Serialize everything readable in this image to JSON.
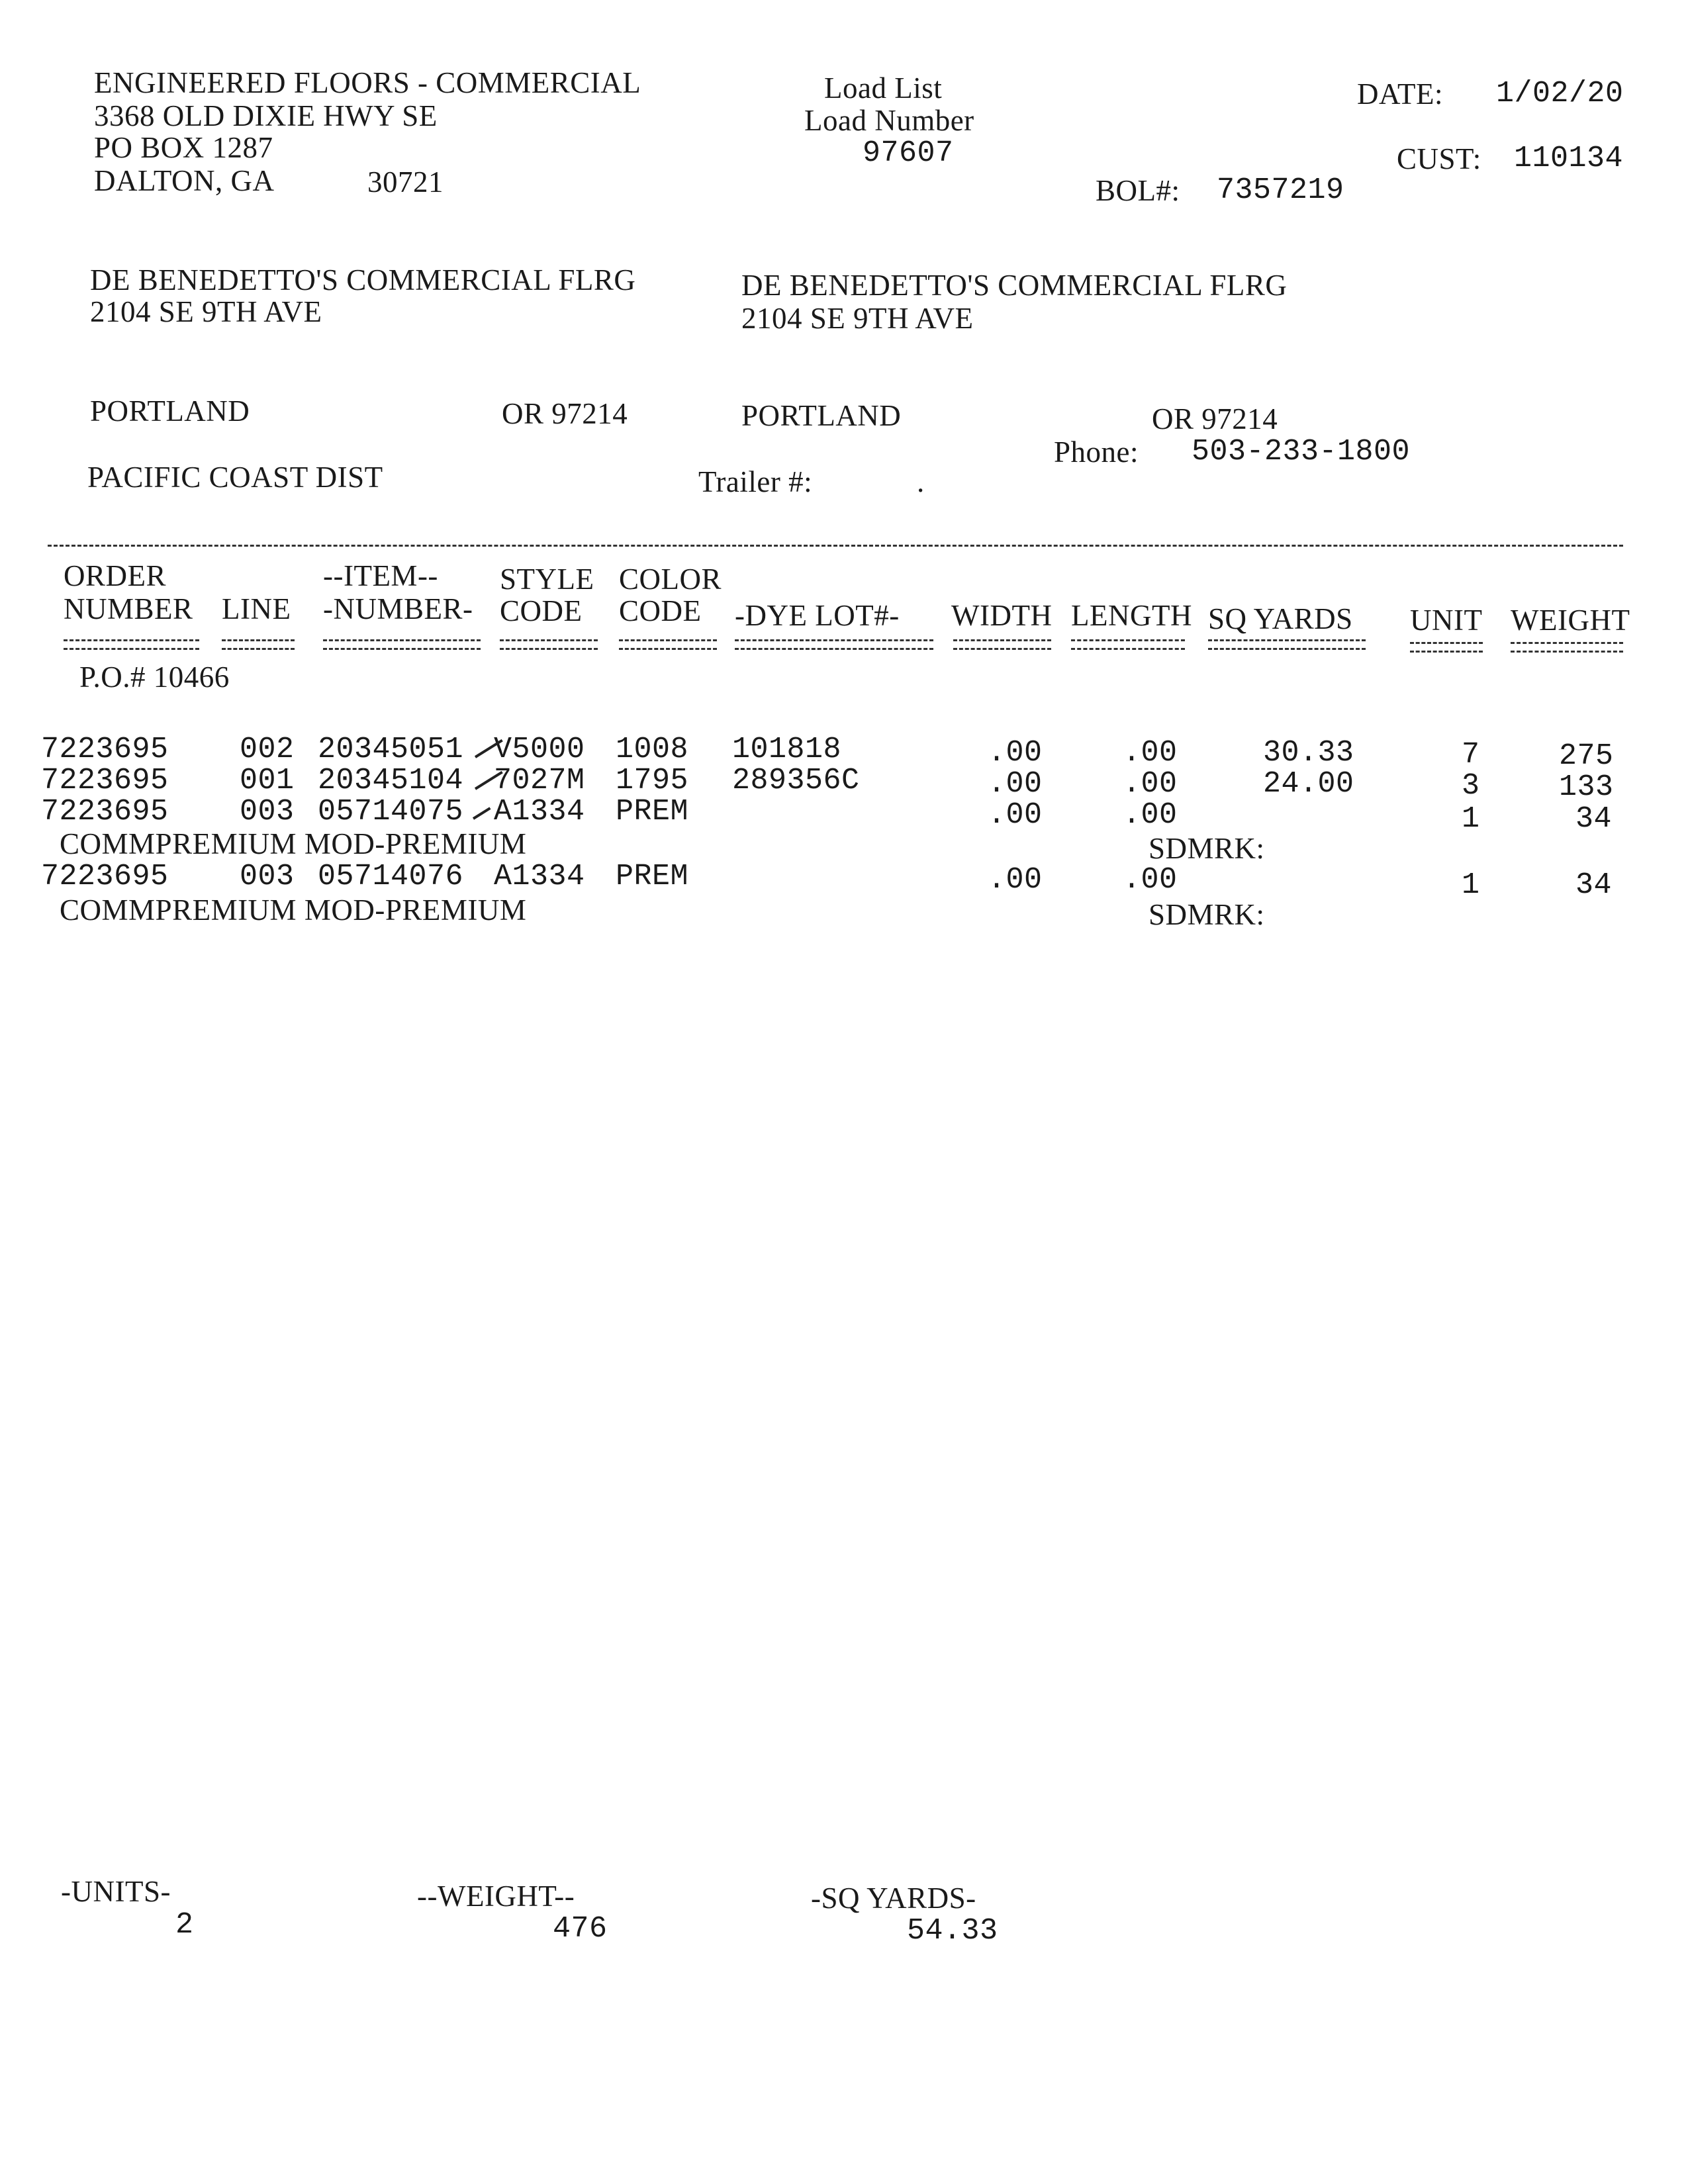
{
  "company": {
    "name": "ENGINEERED FLOORS - COMMERCIAL",
    "address1": "3368 OLD DIXIE HWY SE",
    "address2": "PO BOX 1287",
    "city_state": "DALTON, GA",
    "zip": "30721"
  },
  "doc": {
    "title": "Load List",
    "load_number_label": "Load Number",
    "load_number": "97607",
    "date_label": "DATE:",
    "date": "1/02/20",
    "cust_label": "CUST:",
    "cust": "110134",
    "bol_label": "BOL#:",
    "bol": "7357219"
  },
  "sold_to": {
    "name": "DE BENEDETTO'S COMMERCIAL FLRG",
    "address": "2104 SE 9TH AVE",
    "city": "PORTLAND",
    "state_zip": "OR 97214"
  },
  "ship_to": {
    "name": "DE BENEDETTO'S COMMERCIAL FLRG",
    "address": "2104 SE 9TH AVE",
    "city": "PORTLAND",
    "state_zip": "OR 97214",
    "phone_label": "Phone:",
    "phone": "503-233-1800"
  },
  "carrier": "PACIFIC COAST DIST",
  "trailer_label": "Trailer #:",
  "trailer": ".",
  "headers": {
    "order": [
      "ORDER",
      "NUMBER"
    ],
    "line": "LINE",
    "item": [
      "--ITEM--",
      "-NUMBER-"
    ],
    "style": [
      "STYLE",
      "CODE"
    ],
    "color": [
      "COLOR",
      "CODE"
    ],
    "dye_lot": "-DYE LOT#-",
    "width": "WIDTH",
    "length": "LENGTH",
    "sq_yards": "SQ YARDS",
    "unit": "UNIT",
    "weight": "WEIGHT"
  },
  "po": "P.O.# 10466",
  "rows": [
    {
      "order": "7223695",
      "line": "002",
      "item": "20345051",
      "style": "V5000",
      "color": "1008",
      "dye_lot": "101818",
      "width": ".00",
      "length": ".00",
      "sq_yards": "30.33",
      "unit": "7",
      "weight": "275",
      "desc": "",
      "sdmrk": ""
    },
    {
      "order": "7223695",
      "line": "001",
      "item": "20345104",
      "style": "7027M",
      "color": "1795",
      "dye_lot": "289356C",
      "width": ".00",
      "length": ".00",
      "sq_yards": "24.00",
      "unit": "3",
      "weight": "133",
      "desc": "",
      "sdmrk": ""
    },
    {
      "order": "7223695",
      "line": "003",
      "item": "05714075",
      "style": "A1334",
      "color": "PREM",
      "dye_lot": "",
      "width": ".00",
      "length": ".00",
      "sq_yards": "",
      "unit": "1",
      "weight": "34",
      "desc": "COMMPREMIUM MOD-PREMIUM",
      "sdmrk": "SDMRK:"
    },
    {
      "order": "7223695",
      "line": "003",
      "item": "05714076",
      "style": "A1334",
      "color": "PREM",
      "dye_lot": "",
      "width": ".00",
      "length": ".00",
      "sq_yards": "",
      "unit": "1",
      "weight": "34",
      "desc": "COMMPREMIUM MOD-PREMIUM",
      "sdmrk": "SDMRK:"
    }
  ],
  "totals": {
    "units_label": "-UNITS-",
    "units": "2",
    "weight_label": "--WEIGHT--",
    "weight": "476",
    "sq_yards_label": "-SQ YARDS-",
    "sq_yards": "54.33"
  }
}
